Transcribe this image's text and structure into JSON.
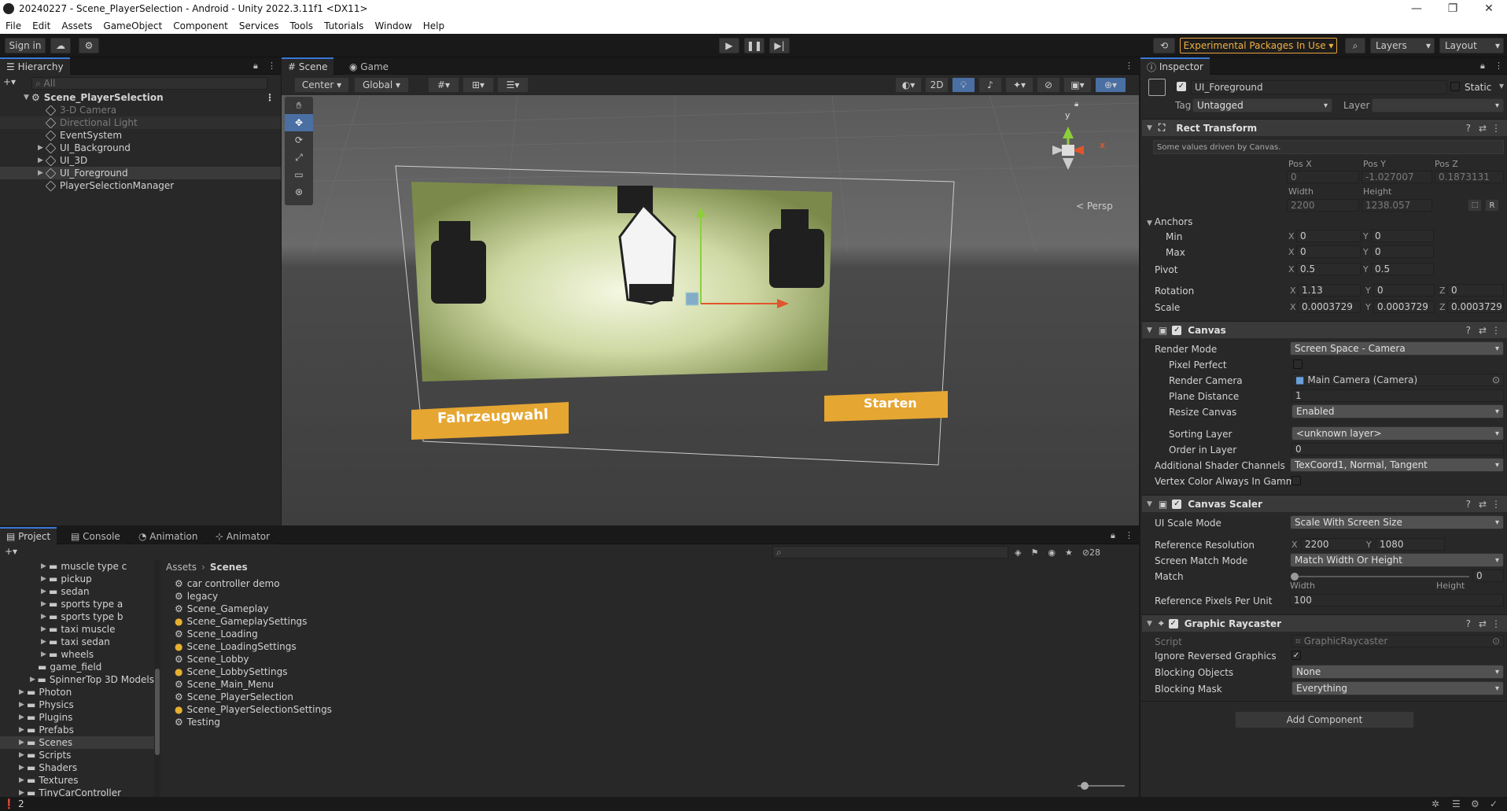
{
  "window": {
    "title": "20240227 - Scene_PlayerSelection - Android - Unity 2022.3.11f1 <DX11>",
    "minimize": "—",
    "maximize": "❐",
    "close": "✕"
  },
  "menu": [
    "File",
    "Edit",
    "Assets",
    "GameObject",
    "Component",
    "Services",
    "Tools",
    "Tutorials",
    "Window",
    "Help"
  ],
  "toolbar": {
    "sign_in": "Sign in",
    "experimental": "Experimental Packages In Use",
    "layers": "Layers",
    "layout": "Layout"
  },
  "hierarchy": {
    "title": "Hierarchy",
    "search_placeholder": "All",
    "scene": "Scene_PlayerSelection",
    "items": [
      {
        "label": "3-D Camera",
        "dim": true
      },
      {
        "label": "Directional Light",
        "dim": true
      },
      {
        "label": "EventSystem",
        "dim": false
      },
      {
        "label": "UI_Background",
        "dim": false
      },
      {
        "label": "UI_3D",
        "dim": false
      },
      {
        "label": "UI_Foreground",
        "dim": false
      },
      {
        "label": "PlayerSelectionManager",
        "dim": false
      }
    ]
  },
  "scene_view": {
    "tab_scene": "Scene",
    "tab_game": "Game",
    "pivot": "Center",
    "space": "Global",
    "mode_2d": "2D",
    "persp": "< Persp",
    "gizmo_y": "y",
    "gizmo_x": "x",
    "btn_vehicle": "Fahrzeugwahl",
    "btn_start": "Starten"
  },
  "project": {
    "tabs": [
      "Project",
      "Console",
      "Animation",
      "Animator"
    ],
    "breadcrumb_root": "Assets",
    "breadcrumb_current": "Scenes",
    "hidden_count": "28",
    "tree": [
      {
        "label": "muscle type c",
        "indent": 3
      },
      {
        "label": "pickup",
        "indent": 3
      },
      {
        "label": "sedan",
        "indent": 3
      },
      {
        "label": "sports type a",
        "indent": 3
      },
      {
        "label": "sports type b",
        "indent": 3
      },
      {
        "label": "taxi muscle",
        "indent": 3
      },
      {
        "label": "taxi sedan",
        "indent": 3
      },
      {
        "label": "wheels",
        "indent": 3
      },
      {
        "label": "game_field",
        "indent": 2
      },
      {
        "label": "SpinnerTop 3D Models",
        "indent": 2
      },
      {
        "label": "Photon",
        "indent": 1
      },
      {
        "label": "Physics",
        "indent": 1
      },
      {
        "label": "Plugins",
        "indent": 1
      },
      {
        "label": "Prefabs",
        "indent": 1
      },
      {
        "label": "Scenes",
        "indent": 1
      },
      {
        "label": "Scripts",
        "indent": 1
      },
      {
        "label": "Shaders",
        "indent": 1
      },
      {
        "label": "Textures",
        "indent": 1
      },
      {
        "label": "TinyCarController",
        "indent": 1
      }
    ],
    "files": [
      {
        "label": "car controller demo",
        "settings": false
      },
      {
        "label": "legacy",
        "settings": false
      },
      {
        "label": "Scene_Gameplay",
        "settings": false
      },
      {
        "label": "Scene_GameplaySettings",
        "settings": true
      },
      {
        "label": "Scene_Loading",
        "settings": false
      },
      {
        "label": "Scene_LoadingSettings",
        "settings": true
      },
      {
        "label": "Scene_Lobby",
        "settings": false
      },
      {
        "label": "Scene_LobbySettings",
        "settings": true
      },
      {
        "label": "Scene_Main_Menu",
        "settings": false
      },
      {
        "label": "Scene_PlayerSelection",
        "settings": false
      },
      {
        "label": "Scene_PlayerSelectionSettings",
        "settings": true
      },
      {
        "label": "Testing",
        "settings": false
      }
    ]
  },
  "inspector": {
    "title": "Inspector",
    "object_name": "UI_Foreground",
    "static": "Static",
    "tag_label": "Tag",
    "tag_value": "Untagged",
    "layer_label": "Layer",
    "layer_value": "",
    "rect": {
      "title": "Rect Transform",
      "note": "Some values driven by Canvas.",
      "posx_lbl": "Pos X",
      "posy_lbl": "Pos Y",
      "posz_lbl": "Pos Z",
      "posx": "0",
      "posy": "-1.027007",
      "posz": "0.1873131",
      "width_lbl": "Width",
      "height_lbl": "Height",
      "width": "2200",
      "height": "1238.057",
      "anchors": "Anchors",
      "min": "Min",
      "max": "Max",
      "minx": "0",
      "miny": "0",
      "maxx": "0",
      "maxy": "0",
      "pivot": "Pivot",
      "pivx": "0.5",
      "pivy": "0.5",
      "rotation": "Rotation",
      "rotx": "1.13",
      "roty": "0",
      "rotz": "0",
      "scale": "Scale",
      "scx": "0.0003729",
      "scy": "0.0003729",
      "scz": "0.0003729",
      "btn_r": "R"
    },
    "canvas": {
      "title": "Canvas",
      "render_mode_lbl": "Render Mode",
      "render_mode": "Screen Space - Camera",
      "pixel_perfect": "Pixel Perfect",
      "render_camera_lbl": "Render Camera",
      "render_camera": "Main Camera (Camera)",
      "plane_distance_lbl": "Plane Distance",
      "plane_distance": "1",
      "resize_lbl": "Resize Canvas",
      "resize": "Enabled",
      "sorting_layer_lbl": "Sorting Layer",
      "sorting_layer": "<unknown layer>",
      "order_lbl": "Order in Layer",
      "order": "0",
      "shader_channels_lbl": "Additional Shader Channels",
      "shader_channels": "TexCoord1, Normal, Tangent",
      "vertex_color_lbl": "Vertex Color Always In Gamma"
    },
    "scaler": {
      "title": "Canvas Scaler",
      "ui_scale_lbl": "UI Scale Mode",
      "ui_scale": "Scale With Screen Size",
      "ref_res_lbl": "Reference Resolution",
      "ref_x": "2200",
      "ref_y": "1080",
      "match_mode_lbl": "Screen Match Mode",
      "match_mode": "Match Width Or Height",
      "match_lbl": "Match",
      "match_value": "0",
      "match_fraction": 0,
      "width_lbl": "Width",
      "height_lbl": "Height",
      "rppu_lbl": "Reference Pixels Per Unit",
      "rppu": "100"
    },
    "raycaster": {
      "title": "Graphic Raycaster",
      "script_lbl": "Script",
      "script": "GraphicRaycaster",
      "ignore_lbl": "Ignore Reversed Graphics",
      "blocking_obj_lbl": "Blocking Objects",
      "blocking_obj": "None",
      "blocking_mask_lbl": "Blocking Mask",
      "blocking_mask": "Everything"
    },
    "add_component": "Add Component"
  },
  "statusbar": {
    "count": "2"
  }
}
